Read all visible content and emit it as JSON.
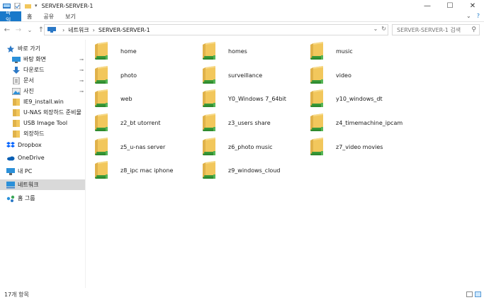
{
  "window": {
    "title": "SERVER-SERVER-1",
    "minimize": "—",
    "maximize": "☐",
    "close": "✕"
  },
  "ribbon": {
    "tabs": [
      "파일",
      "홈",
      "공유",
      "보기"
    ],
    "collapse": "⌄",
    "help": "?"
  },
  "nav": {
    "back": "←",
    "forward": "→",
    "recent": "⌄",
    "up": "↑",
    "breadcrumb": [
      "네트워크",
      "SERVER-SERVER-1"
    ],
    "breadcrumb_sep": "›",
    "dropdown": "⌄",
    "refresh": "↻",
    "search_placeholder": "SERVER-SERVER-1 검색",
    "search_icon": "⚲"
  },
  "sidebar": {
    "items": [
      {
        "label": "바로 가기",
        "icon": "star-icon",
        "pinned": false
      },
      {
        "label": "바탕 화면",
        "icon": "desktop-icon",
        "pinned": true
      },
      {
        "label": "다운로드",
        "icon": "download-icon",
        "pinned": true
      },
      {
        "label": "문서",
        "icon": "document-icon",
        "pinned": true
      },
      {
        "label": "사진",
        "icon": "pictures-icon",
        "pinned": true
      },
      {
        "label": "IE9_install.win",
        "icon": "folder-icon",
        "pinned": false
      },
      {
        "label": "U-NAS 외장하드 준비물",
        "icon": "folder-icon",
        "pinned": false
      },
      {
        "label": "USB Image Tool",
        "icon": "folder-icon",
        "pinned": false
      },
      {
        "label": "외장하드",
        "icon": "folder-icon",
        "pinned": false
      },
      {
        "label": "Dropbox",
        "icon": "dropbox-icon",
        "pinned": false
      },
      {
        "label": "OneDrive",
        "icon": "onedrive-icon",
        "pinned": false
      },
      {
        "label": "내 PC",
        "icon": "pc-icon",
        "pinned": false
      },
      {
        "label": "네트워크",
        "icon": "network-icon",
        "pinned": false
      },
      {
        "label": "홈 그룹",
        "icon": "homegroup-icon",
        "pinned": false
      }
    ],
    "pin_glyph": "⊸"
  },
  "folders": [
    "home",
    "homes",
    "music",
    "photo",
    "surveillance",
    "video",
    "web",
    "Y0_Windows 7_64bit",
    "y10_windows_dt",
    "z2_bt utorrent",
    "z3_users share",
    "z4_timemachine_ipcam",
    "z5_u-nas server",
    "z6_photo music",
    "z7_video movies",
    "z8_ipc mac iphone",
    "z9_windows_cloud"
  ],
  "status": {
    "count": "17개 항목"
  },
  "colors": {
    "accent": "#1979ca",
    "folder": "#f2c75c",
    "share_pipe": "#3a9a3a"
  }
}
